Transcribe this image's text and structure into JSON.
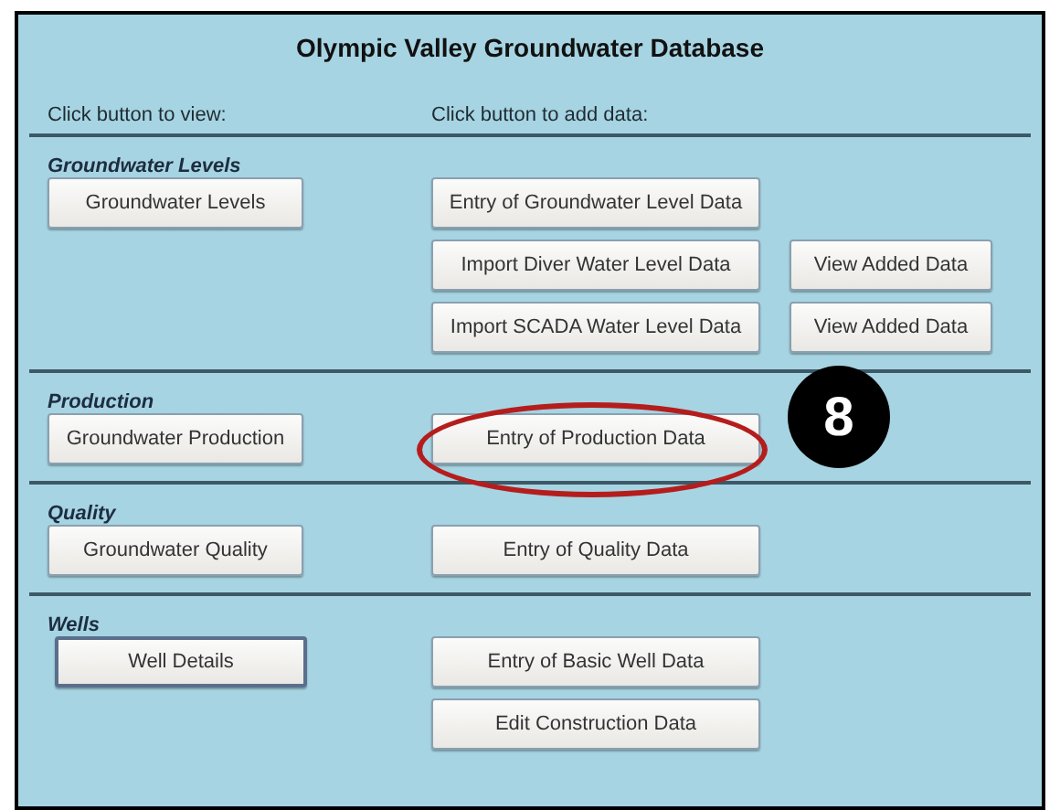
{
  "title": "Olympic Valley Groundwater Database",
  "headers": [
    "Click button to view:",
    "Click button to add data:"
  ],
  "sections": [
    {
      "title": "Groundwater Levels",
      "rows": [
        {
          "view": {
            "label": "Groundwater Levels",
            "focused": false
          },
          "add": {
            "label": "Entry of Groundwater Level Data"
          }
        },
        {
          "add": {
            "label": "Import Diver Water Level Data"
          },
          "extra": {
            "label": "View Added Data"
          }
        },
        {
          "add": {
            "label": "Import SCADA Water Level Data"
          },
          "extra": {
            "label": "View Added Data"
          }
        }
      ]
    },
    {
      "title": "Production",
      "rows": [
        {
          "view": {
            "label": "Groundwater Production",
            "focused": false
          },
          "add": {
            "label": "Entry of Production Data"
          }
        }
      ]
    },
    {
      "title": "Quality",
      "rows": [
        {
          "view": {
            "label": "Groundwater Quality",
            "focused": false
          },
          "add": {
            "label": "Entry of Quality Data"
          }
        }
      ]
    },
    {
      "title": "Wells",
      "rows": [
        {
          "view": {
            "label": "Well Details",
            "focused": true
          },
          "add": {
            "label": "Entry of Basic Well Data"
          }
        },
        {
          "add": {
            "label": "Edit Construction Data"
          }
        }
      ]
    }
  ],
  "callout": {
    "number": "8"
  }
}
